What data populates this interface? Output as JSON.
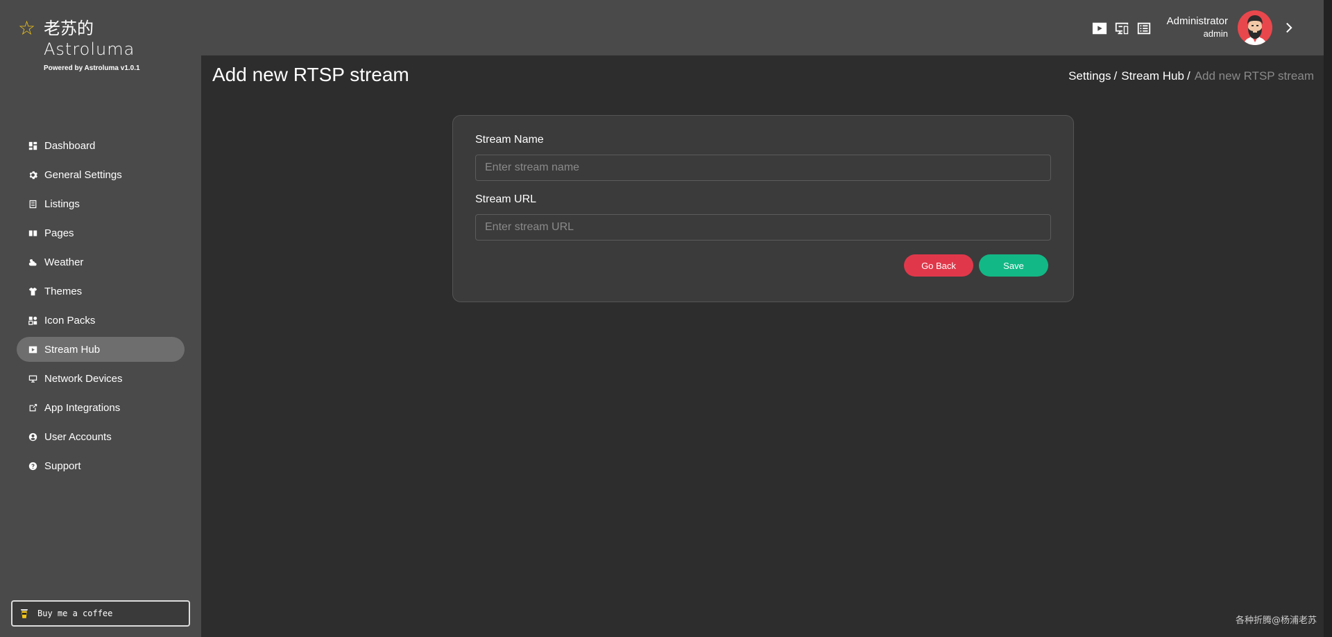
{
  "brand": {
    "name_cn": "老苏的",
    "name": "Astroluma",
    "powered_by": "Powered by Astroluma v1.0.1",
    "star_color": "#f0c419",
    "icon": "star-icon"
  },
  "sidebar": {
    "items": [
      {
        "label": "Dashboard",
        "icon": "dashboard-icon"
      },
      {
        "label": "General Settings",
        "icon": "gear-icon"
      },
      {
        "label": "Listings",
        "icon": "list-icon"
      },
      {
        "label": "Pages",
        "icon": "pages-icon"
      },
      {
        "label": "Weather",
        "icon": "weather-icon"
      },
      {
        "label": "Themes",
        "icon": "tshirt-icon"
      },
      {
        "label": "Icon Packs",
        "icon": "icon-packs-icon"
      },
      {
        "label": "Stream Hub",
        "icon": "play-icon",
        "active": true
      },
      {
        "label": "Network Devices",
        "icon": "network-icon"
      },
      {
        "label": "App Integrations",
        "icon": "integration-icon"
      },
      {
        "label": "User Accounts",
        "icon": "user-icon"
      },
      {
        "label": "Support",
        "icon": "help-icon"
      }
    ],
    "coffee_label": "Buy me a coffee"
  },
  "header": {
    "icons": [
      "play-icon",
      "devices-icon",
      "list-icon"
    ],
    "user_role": "Administrator",
    "user_name": "admin"
  },
  "page": {
    "title": "Add new RTSP stream",
    "breadcrumb": [
      "Settings",
      "Stream Hub",
      "Add new RTSP stream"
    ]
  },
  "form": {
    "name_label": "Stream Name",
    "name_placeholder": "Enter stream name",
    "name_value": "",
    "url_label": "Stream URL",
    "url_placeholder": "Enter stream URL",
    "url_value": "",
    "back_label": "Go Back",
    "save_label": "Save"
  },
  "colors": {
    "back_button": "#e0384a",
    "save_button": "#12b886",
    "active_nav": "#6e6e6e"
  },
  "watermark": "各种折腾@杨浦老苏"
}
